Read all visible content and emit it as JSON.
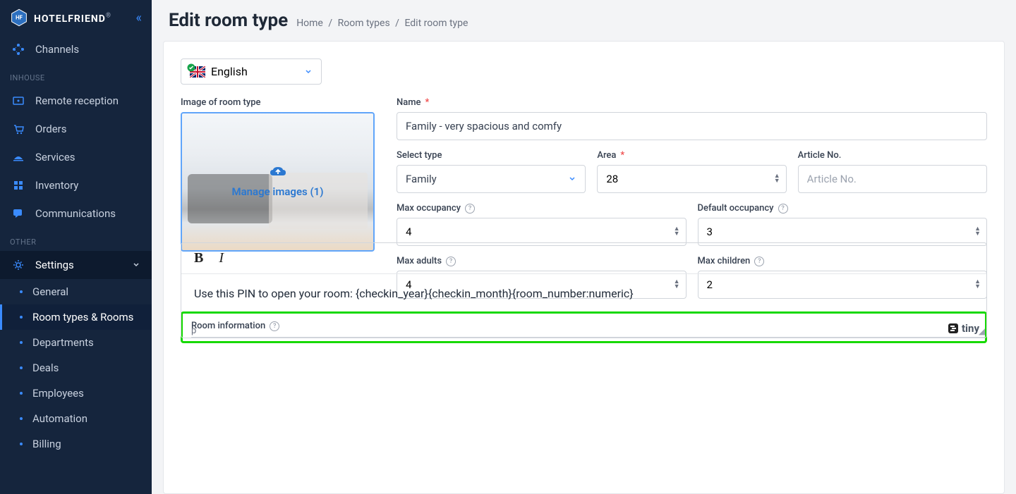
{
  "logo": {
    "text": "HOTELFRIEND",
    "sup": "®"
  },
  "nav": {
    "channels": "Channels",
    "sectionInhouse": "INHOUSE",
    "remoteReception": "Remote reception",
    "orders": "Orders",
    "services": "Services",
    "inventory": "Inventory",
    "communications": "Communications",
    "sectionOther": "OTHER",
    "settings": "Settings",
    "sub": {
      "general": "General",
      "roomTypes": "Room types & Rooms",
      "departments": "Departments",
      "deals": "Deals",
      "employees": "Employees",
      "automation": "Automation",
      "billing": "Billing"
    }
  },
  "header": {
    "title": "Edit room type",
    "bc": {
      "home": "Home",
      "roomTypes": "Room types",
      "current": "Edit room type"
    }
  },
  "lang": {
    "label": "English"
  },
  "image": {
    "label": "Image of room type",
    "manage": "Manage images (1)"
  },
  "form": {
    "name": {
      "label": "Name",
      "value": "Family - very spacious and comfy"
    },
    "selectType": {
      "label": "Select type",
      "value": "Family"
    },
    "area": {
      "label": "Area",
      "value": "28"
    },
    "articleNo": {
      "label": "Article No.",
      "placeholder": "Article No.",
      "value": ""
    },
    "maxOccupancy": {
      "label": "Max occupancy",
      "value": "4"
    },
    "defaultOccupancy": {
      "label": "Default occupancy",
      "value": "3"
    },
    "maxAdults": {
      "label": "Max adults",
      "value": "4"
    },
    "maxChildren": {
      "label": "Max children",
      "value": "2"
    }
  },
  "roomInfo": {
    "label": "Room information",
    "content": "Use this PIN to open your room: {checkin_year}{checkin_month}{room_number:numeric}",
    "brand": "tiny",
    "statusPath": "p"
  }
}
